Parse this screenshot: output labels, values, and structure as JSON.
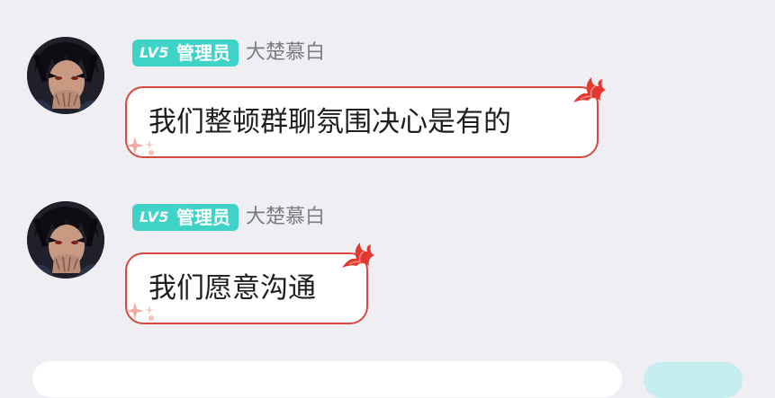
{
  "messages": [
    {
      "badge_level": "LV5",
      "badge_role": "管理员",
      "sender": "大楚慕白",
      "text": "我们整顿群聊氛围决心是有的"
    },
    {
      "badge_level": "LV5",
      "badge_role": "管理员",
      "sender": "大楚慕白",
      "text": "我们愿意沟通"
    }
  ],
  "icons": {
    "avatar": "anime-character-avatar",
    "bubble_decoration": "red-flame-icon",
    "bubble_sparkle": "sparkle-icon"
  },
  "colors": {
    "background": "#eeeef3",
    "badge": "#3fd2c7",
    "bubble_border": "#d9473f",
    "sender_name": "#7b7b86",
    "send_button": "#c6eef2"
  }
}
